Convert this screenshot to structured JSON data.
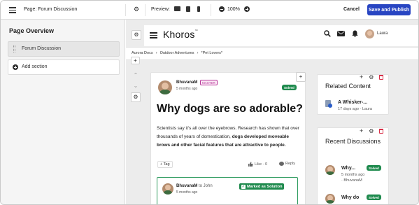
{
  "topbar": {
    "page_label": "Page: Forum Discussion",
    "preview_label": "Preview:",
    "zoom": "100%",
    "cancel_label": "Cancel",
    "publish_label": "Save and Publish"
  },
  "left_panel": {
    "title": "Page Overview",
    "sections": [
      "Forum Discussion"
    ],
    "add_section_label": "Add section"
  },
  "site_header": {
    "logo": "Khoros",
    "user": "Laura",
    "icons": [
      "search-icon",
      "mail-icon",
      "bell-icon"
    ]
  },
  "breadcrumb": [
    "Aurora Docs",
    "Outdoor Adventures",
    "*Pet Lovers*"
  ],
  "post": {
    "author": "BhuvanaM",
    "rank": "MASTER",
    "time": "5 months ago",
    "status": "Solved",
    "title": "Why dogs are so adorable?",
    "body_plain": "Scientists say it's all over the eyebrows. Research has shown that over thousands of years of domestication, ",
    "body_bold": "dogs developed moveable brows and other facial features that are attractive to people.",
    "tag_label": "Tag",
    "like_label": "Like · 0",
    "reply_label": "Reply"
  },
  "solution_reply": {
    "author": "BhuvanaM",
    "to_text": "to John",
    "time": "5 months ago",
    "badge": "Marked as Solution"
  },
  "related_content": {
    "title": "Related Content",
    "item_title": "A Whisker-...",
    "item_meta": "17 days ago · Laura"
  },
  "recent_discussions": {
    "title": "Recent Discussions",
    "items": [
      {
        "title": "Why...",
        "status": "Solved",
        "time": "5 months ago",
        "author": "· BhuvanaM"
      },
      {
        "title": "Why do",
        "status": "Solved"
      }
    ]
  },
  "colors": {
    "primary": "#2845c2",
    "solved_green": "#1e8a4d",
    "rank_pink": "#b8399a",
    "delete_red": "#d9324a"
  }
}
